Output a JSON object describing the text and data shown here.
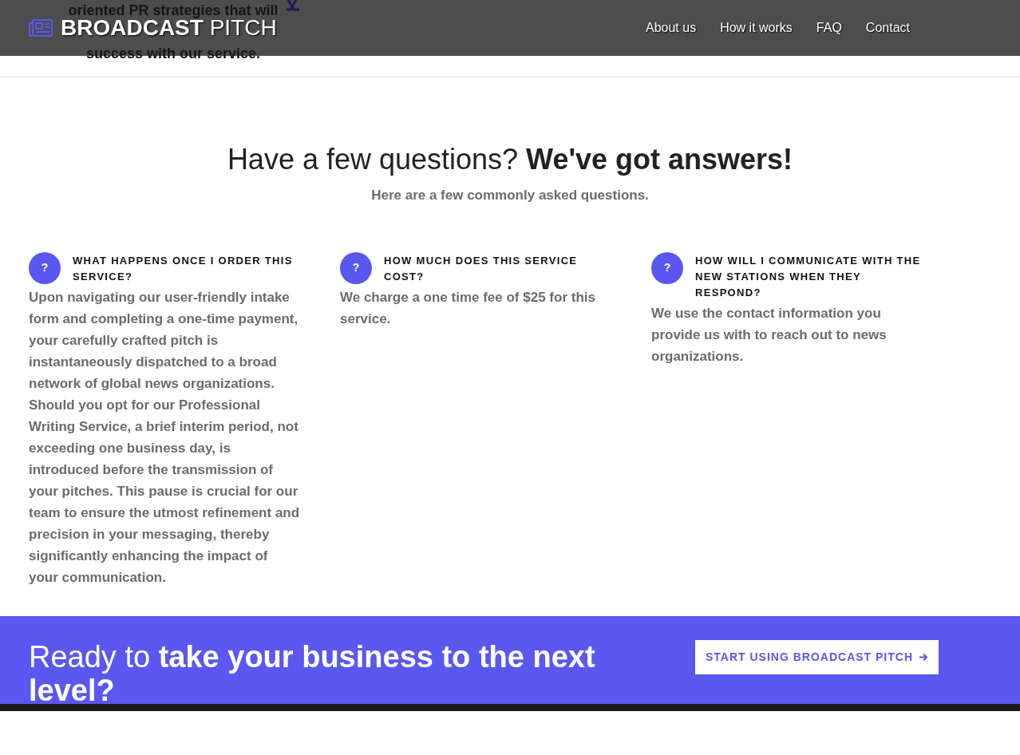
{
  "backdrop_lines": [
    "oriented PR strategies that will",
    "success with our service."
  ],
  "header": {
    "brand_bold": "BROADCAST",
    "brand_light": "PITCH",
    "nav": [
      {
        "label": "About us"
      },
      {
        "label": "How it works"
      },
      {
        "label": "FAQ"
      },
      {
        "label": "Contact"
      }
    ]
  },
  "faq": {
    "title": "Have a few questions? **We've got answers!**",
    "subtitle": "Here are a few commonly asked questions.",
    "items": [
      {
        "icon": "?",
        "question": "WHAT HAPPENS ONCE I ORDER THIS SERVICE?",
        "answer": "Upon navigating our user-friendly intake form and completing a one-time payment, your carefully crafted pitch is instantaneously dispatched to a broad network of global news organizations. Should you opt for our Professional Writing Service, a brief interim period, not exceeding one business day, is introduced before the transmission of your pitches. This pause is crucial for our team to ensure the utmost refinement and precision in your messaging, thereby significantly enhancing the impact of your communication."
      },
      {
        "icon": "?",
        "question": "HOW MUCH DOES THIS SERVICE COST?",
        "answer": "We charge a one time fee of $25 for this service."
      },
      {
        "icon": "?",
        "question": "HOW WILL I COMMUNICATE WITH THE NEW STATIONS WHEN THEY RESPOND?",
        "answer": "We use the contact information you provide us with to reach out to news organizations."
      }
    ]
  },
  "cta": {
    "title": "Ready to **take your business to the next level?**",
    "button": "START USING BROADCAST PITCH"
  }
}
